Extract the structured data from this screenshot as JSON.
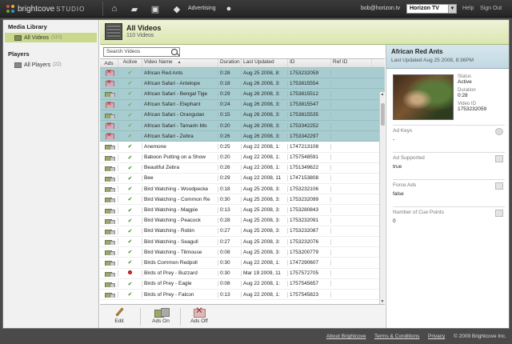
{
  "app": {
    "brand": "brightcove",
    "product": "STUDIO",
    "advertising_label": "Advertising",
    "user_email": "bob@horizon.tv",
    "account": "Horizon TV",
    "help_label": "Help",
    "signout_label": "Sign Out"
  },
  "sidebar": {
    "media_header": "Media Library",
    "all_videos_label": "All Videos",
    "all_videos_count": "(110)",
    "players_header": "Players",
    "all_players_label": "All Players",
    "all_players_count": "(22)"
  },
  "main": {
    "title": "All Videos",
    "subtitle": "110 Videos",
    "search_placeholder": "Search Videos"
  },
  "grid": {
    "columns": [
      "Ads",
      "Active",
      "Video Name",
      "Duration",
      "Last Updated",
      "ID",
      "Ref ID"
    ],
    "rows": [
      {
        "ads": "off",
        "active": "check",
        "name": "African Red Ants",
        "duration": "0:28",
        "updated": "Aug 25 2008, 8:",
        "id": "1753232059",
        "ref": "",
        "selected": true
      },
      {
        "ads": "off",
        "active": "check",
        "name": "African Safari - Antelope",
        "duration": "0:18",
        "updated": "Aug 26 2008, 3:",
        "id": "1753815554",
        "ref": "",
        "selected": true
      },
      {
        "ads": "on",
        "active": "check",
        "name": "African Safari - Bengal Tige",
        "duration": "0:29",
        "updated": "Aug 26 2008, 3:",
        "id": "1753815512",
        "ref": "",
        "selected": true
      },
      {
        "ads": "off",
        "active": "check",
        "name": "African Safari - Elephant",
        "duration": "0:24",
        "updated": "Aug 26 2008, 3:",
        "id": "1753815547",
        "ref": "",
        "selected": true
      },
      {
        "ads": "on",
        "active": "check",
        "name": "African Safari - Orangutan",
        "duration": "0:15",
        "updated": "Aug 26 2008, 3:",
        "id": "1753815535",
        "ref": "",
        "selected": true
      },
      {
        "ads": "off",
        "active": "check",
        "name": "African Safari - Tamarin Mo",
        "duration": "0:20",
        "updated": "Aug 26 2008, 3:",
        "id": "1753342252",
        "ref": "",
        "selected": true
      },
      {
        "ads": "off",
        "active": "check",
        "name": "African Safari - Zebra",
        "duration": "0:26",
        "updated": "Aug 26 2008, 3:",
        "id": "1753342297",
        "ref": "",
        "selected": true
      },
      {
        "ads": "on",
        "active": "check",
        "name": "Anemone",
        "duration": "0:25",
        "updated": "Aug 22 2008, 1:",
        "id": "1747213108",
        "ref": "",
        "selected": false
      },
      {
        "ads": "on",
        "active": "check",
        "name": "Baboon Putting on a Show",
        "duration": "0:20",
        "updated": "Aug 22 2008, 1:",
        "id": "1757548591",
        "ref": "",
        "selected": false
      },
      {
        "ads": "on",
        "active": "check",
        "name": "Beautiful Zebra",
        "duration": "0:26",
        "updated": "Aug 22 2008, 1:",
        "id": "1751349622",
        "ref": "",
        "selected": false
      },
      {
        "ads": "on",
        "active": "check",
        "name": "Bee",
        "duration": "0:29",
        "updated": "Aug 22 2008, 11",
        "id": "1747153808",
        "ref": "",
        "selected": false
      },
      {
        "ads": "on",
        "active": "check",
        "name": "Bird Watching - Woodpecke",
        "duration": "0:18",
        "updated": "Aug 25 2008, 3:",
        "id": "1753232106",
        "ref": "",
        "selected": false
      },
      {
        "ads": "on",
        "active": "check",
        "name": "Bird Watching - Common Re",
        "duration": "0:30",
        "updated": "Aug 25 2008, 3:",
        "id": "1753232099",
        "ref": "",
        "selected": false
      },
      {
        "ads": "on",
        "active": "check",
        "name": "Bird Watching - Magpie",
        "duration": "0:13",
        "updated": "Aug 25 2008, 3:",
        "id": "1753280843",
        "ref": "",
        "selected": false
      },
      {
        "ads": "on",
        "active": "check",
        "name": "Bird Watching - Peacock",
        "duration": "0:28",
        "updated": "Aug 25 2008, 3:",
        "id": "1753232091",
        "ref": "",
        "selected": false
      },
      {
        "ads": "on",
        "active": "check",
        "name": "Bird Watching - Robin",
        "duration": "0:27",
        "updated": "Aug 25 2008, 3:",
        "id": "1753232087",
        "ref": "",
        "selected": false
      },
      {
        "ads": "on",
        "active": "check",
        "name": "Bird Watching - Seagull",
        "duration": "0:27",
        "updated": "Aug 25 2008, 3:",
        "id": "1753232076",
        "ref": "",
        "selected": false
      },
      {
        "ads": "on",
        "active": "check",
        "name": "Bird Watching - Titmouse",
        "duration": "0:08",
        "updated": "Aug 25 2008, 3:",
        "id": "1753200779",
        "ref": "",
        "selected": false
      },
      {
        "ads": "on",
        "active": "check",
        "name": "Birds Common Redpoll",
        "duration": "0:30",
        "updated": "Aug 22 2008, 1:",
        "id": "1747290607",
        "ref": "",
        "selected": false
      },
      {
        "ads": "on",
        "active": "stop",
        "name": "Birds of Prey - Buzzard",
        "duration": "0:30",
        "updated": "Mar 19 2009, 11",
        "id": "1757572705",
        "ref": "",
        "selected": false
      },
      {
        "ads": "on",
        "active": "check",
        "name": "Birds of Prey - Eagle",
        "duration": "0:08",
        "updated": "Aug 22 2008, 1:",
        "id": "1757545657",
        "ref": "",
        "selected": false
      },
      {
        "ads": "on",
        "active": "check",
        "name": "Birds of Prey - Falcon",
        "duration": "0:13",
        "updated": "Aug 22 2008, 1:",
        "id": "1757545823",
        "ref": "",
        "selected": false
      }
    ]
  },
  "actions": {
    "edit_label": "Edit",
    "ads_on_label": "Ads On",
    "ads_off_label": "Ads Off"
  },
  "detail": {
    "title": "African Red Ants",
    "last_updated": "Last Updated Aug 25 2008, 8:36PM",
    "status_label": "Status",
    "status_value": "Active",
    "duration_label": "Duration",
    "duration_value": "0:28",
    "videoid_label": "Video ID",
    "videoid_value": "1753232059",
    "ad_keys_label": "Ad Keys",
    "ad_keys_value": "-",
    "ad_supported_label": "Ad Supported",
    "ad_supported_value": "true",
    "force_ads_label": "Force Ads",
    "force_ads_value": "false",
    "cue_points_label": "Number of Cue Points",
    "cue_points_value": "0"
  },
  "footer": {
    "about": "About Brightcove",
    "terms": "Terms & Conditions",
    "privacy": "Privacy",
    "copyright": "© 2009 Brightcove Inc."
  }
}
